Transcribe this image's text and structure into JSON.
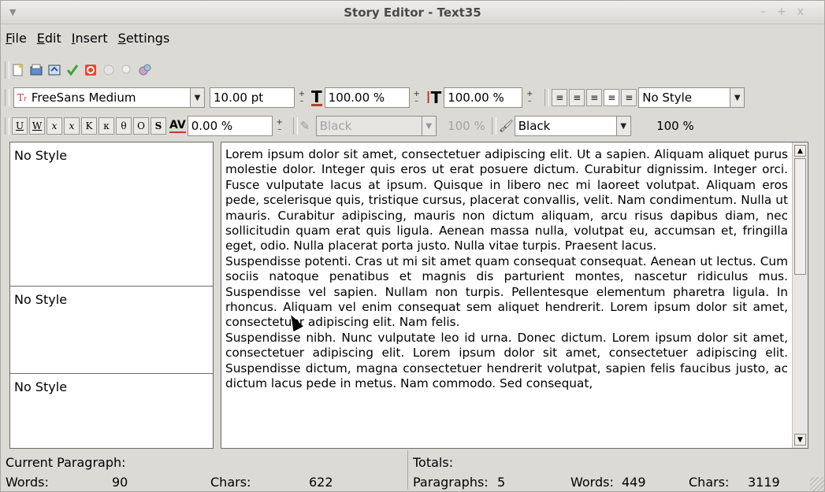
{
  "window": {
    "title": "Story Editor - Text35"
  },
  "menu": {
    "file": "File",
    "edit": "Edit",
    "insert": "Insert",
    "settings": "Settings"
  },
  "toolbar_icons": [
    "new-doc-icon",
    "open-icon",
    "reload-icon",
    "checkmark-icon",
    "stop-icon",
    "update-icon",
    "search-icon",
    "font-preview-icon"
  ],
  "font_bar": {
    "font_name": "FreeSans Medium",
    "font_size": "10.00 pt",
    "scale_h": "100.00 %",
    "scale_v": "100.00 %",
    "style": "No Style"
  },
  "format_bar": {
    "buttons": [
      "U",
      "W",
      "x",
      "x",
      "K",
      "κ",
      "O",
      "O",
      "S"
    ],
    "tracking": "0.00 %",
    "stroke_color": "Black",
    "stroke_shade": "100 %",
    "fill_color": "Black",
    "fill_shade": "100 %"
  },
  "styles": [
    "No Style",
    "No Style",
    "No Style"
  ],
  "paragraphs": [
    "Lorem ipsum dolor sit amet, consectetuer adipiscing elit. Ut a sapien. Aliquam aliquet purus molestie dolor. Integer quis eros ut erat posuere dictum. Curabitur dignissim. Integer orci. Fusce vulputate lacus at ipsum. Quisque in libero nec mi laoreet volutpat. Aliquam eros pede, scelerisque quis, tristique cursus, placerat convallis, velit. Nam condimentum. Nulla ut mauris. Curabitur adipiscing, mauris non dictum aliquam, arcu risus dapibus diam, nec sollicitudin quam erat quis ligula. Aenean massa nulla, volutpat eu, accumsan et, fringilla eget, odio. Nulla placerat porta justo. Nulla vitae turpis. Praesent lacus.",
    "Suspendisse potenti. Cras ut mi sit amet quam consequat consequat. Aenean ut lectus. Cum sociis natoque penatibus et magnis dis parturient montes, nascetur ridiculus mus. Suspendisse vel sapien. Nullam non turpis. Pellentesque elementum pharetra ligula. In rhoncus. Aliquam vel enim consequat sem aliquet hendrerit. Lorem ipsum dolor sit amet, consectetuer adipiscing elit. Nam felis.",
    "Suspendisse nibh. Nunc vulputate leo id urna. Donec dictum. Lorem ipsum dolor sit amet, consectetuer adipiscing elit. Lorem ipsum dolor sit amet, consectetuer adipiscing elit. Suspendisse dictum, magna consectetuer hendrerit volutpat, sapien felis faucibus justo, ac dictum lacus pede in metus. Nam commodo. Sed consequat,"
  ],
  "status": {
    "current_label": "Current Paragraph:",
    "words_label": "Words:",
    "words_value": "90",
    "chars_label": "Chars:",
    "chars_value": "622",
    "totals_label": "Totals:",
    "paragraphs_label": "Paragraphs:",
    "paragraphs_value": "5",
    "total_words_label": "Words:",
    "total_words_value": "449",
    "total_chars_label": "Chars:",
    "total_chars_value": "3119"
  }
}
